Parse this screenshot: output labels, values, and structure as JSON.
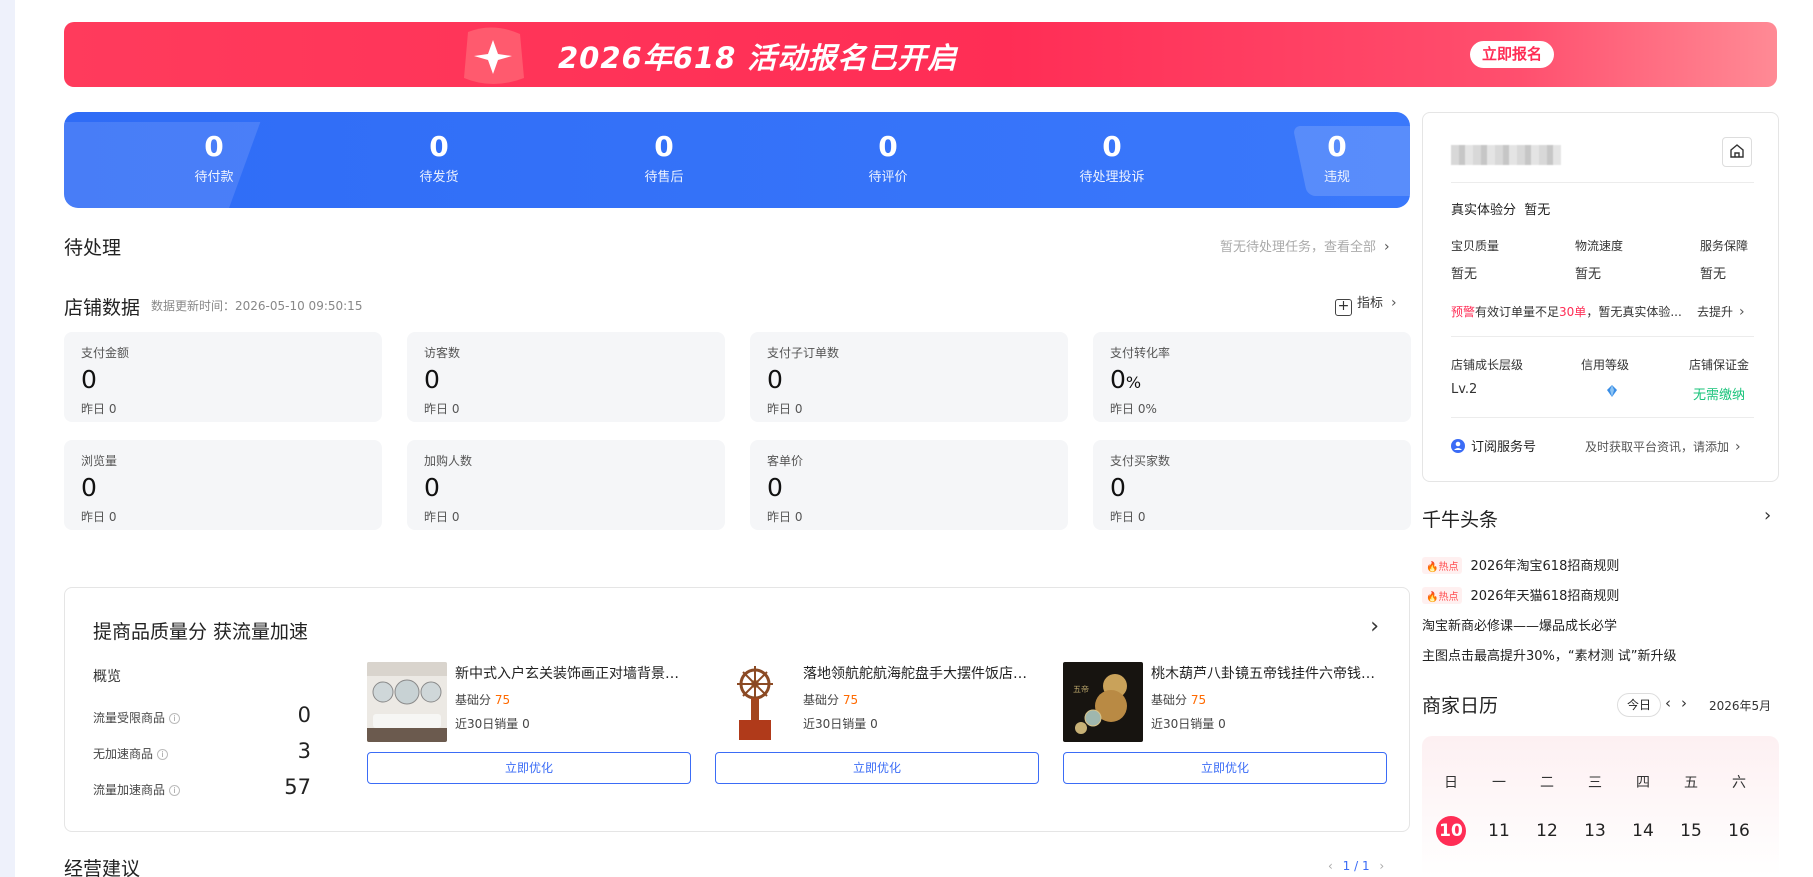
{
  "banner": {
    "title": "2026年618 活动报名已开启",
    "button": "立即报名"
  },
  "stats": [
    {
      "value": "0",
      "label": "待付款"
    },
    {
      "value": "0",
      "label": "待发货"
    },
    {
      "value": "0",
      "label": "待售后"
    },
    {
      "value": "0",
      "label": "待评价"
    },
    {
      "value": "0",
      "label": "待处理投诉"
    },
    {
      "value": "0",
      "label": "违规"
    }
  ],
  "pending": {
    "title": "待处理",
    "link": "暂无待处理任务，查看全部"
  },
  "shop_data": {
    "title": "店铺数据",
    "update_time": "数据更新时间：2026-05-10 09:50:15",
    "indicator_label": "指标",
    "cards": [
      {
        "label": "支付金额",
        "value": "0",
        "unit": "",
        "yesterday": "昨日 0"
      },
      {
        "label": "访客数",
        "value": "0",
        "unit": "",
        "yesterday": "昨日 0"
      },
      {
        "label": "支付子订单数",
        "value": "0",
        "unit": "",
        "yesterday": "昨日 0"
      },
      {
        "label": "支付转化率",
        "value": "0",
        "unit": "%",
        "yesterday": "昨日 0%"
      },
      {
        "label": "浏览量",
        "value": "0",
        "unit": "",
        "yesterday": "昨日 0"
      },
      {
        "label": "加购人数",
        "value": "0",
        "unit": "",
        "yesterday": "昨日 0"
      },
      {
        "label": "客单价",
        "value": "0",
        "unit": "",
        "yesterday": "昨日 0"
      },
      {
        "label": "支付买家数",
        "value": "0",
        "unit": "",
        "yesterday": "昨日 0"
      }
    ]
  },
  "quality": {
    "title": "提商品质量分 获流量加速",
    "overview_title": "概览",
    "overview": [
      {
        "label": "流量受限商品",
        "value": "0"
      },
      {
        "label": "无加速商品",
        "value": "3"
      },
      {
        "label": "流量加速商品",
        "value": "57"
      }
    ],
    "products": [
      {
        "name": "新中式入户玄关装饰画正对墙背景墙...",
        "score_label": "基础分",
        "score": "75",
        "sales": "近30日销量 0",
        "button": "立即优化"
      },
      {
        "name": "落地领航舵航海舵盘手大摆件饭店酒...",
        "score_label": "基础分",
        "score": "75",
        "sales": "近30日销量 0",
        "button": "立即优化"
      },
      {
        "name": "桃木葫芦八卦镜五帝钱挂件六帝钱铜...",
        "score_label": "基础分",
        "score": "75",
        "sales": "近30日销量 0",
        "button": "立即优化"
      }
    ]
  },
  "advice": {
    "title": "经营建议",
    "pager": "1 / 1"
  },
  "shop_panel": {
    "experience_label": "真实体验分",
    "experience_value": "暂无",
    "metrics": [
      {
        "label": "宝贝质量",
        "value": "暂无"
      },
      {
        "label": "物流速度",
        "value": "暂无"
      },
      {
        "label": "服务保障",
        "value": "暂无"
      }
    ],
    "warning_tag": "预警",
    "warning_text_1": "有效订单量不足",
    "warning_num": "30单",
    "warning_text_2": "，暂无真实体验...",
    "warning_link": "去提升",
    "levels": [
      {
        "label": "店铺成长层级",
        "value": "Lv.2"
      },
      {
        "label": "信用等级",
        "value": ""
      },
      {
        "label": "店铺保证金",
        "value": "无需缴纳"
      }
    ],
    "subscribe_label": "订阅服务号",
    "subscribe_hint": "及时获取平台资讯，请添加"
  },
  "news": {
    "title": "千牛头条",
    "hot_tag": "热点",
    "items": [
      {
        "hot": true,
        "text": "2026年淘宝618招商规则"
      },
      {
        "hot": true,
        "text": "2026年天猫618招商规则"
      },
      {
        "hot": false,
        "text": "淘宝新商必修课——爆品成长必学"
      },
      {
        "hot": false,
        "text": "主图点击最高提升30%，“素材测 试”新升级"
      }
    ]
  },
  "calendar": {
    "title": "商家日历",
    "today_btn": "今日",
    "month": "2026年5月",
    "weekdays": [
      "日",
      "一",
      "二",
      "三",
      "四",
      "五",
      "六"
    ],
    "days": [
      "10",
      "11",
      "12",
      "13",
      "14",
      "15",
      "16"
    ],
    "today": "10"
  },
  "colors": {
    "brand_red": "#ff2d55",
    "brand_blue": "#3a78fb",
    "score_orange": "#ff6a00",
    "ok_green": "#18c37a"
  }
}
